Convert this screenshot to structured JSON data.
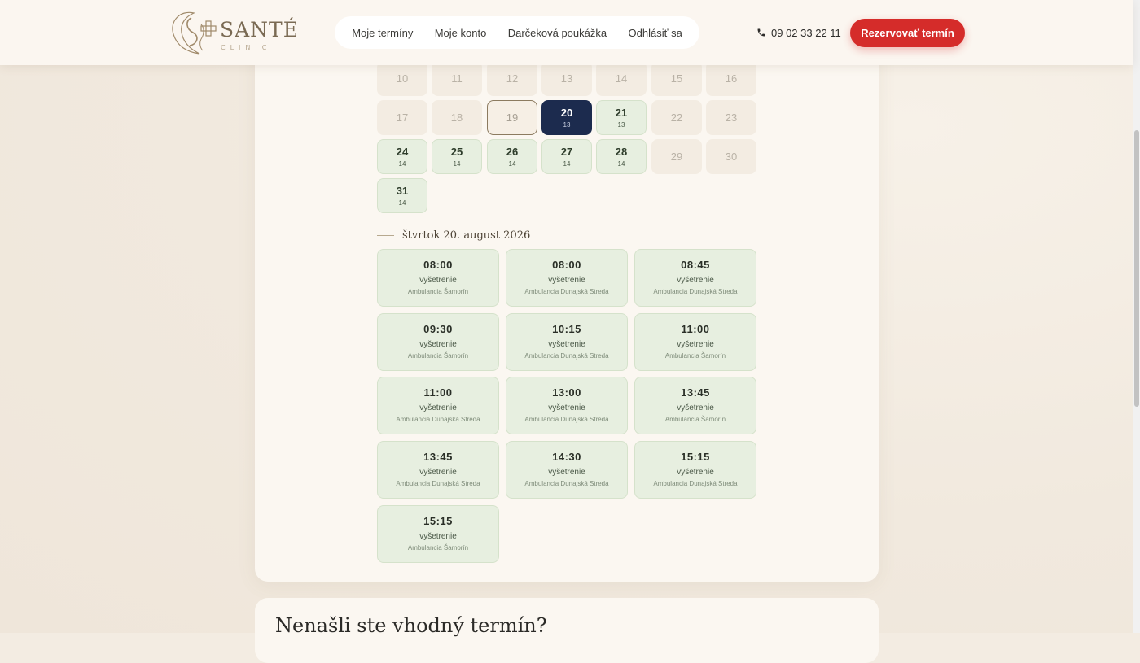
{
  "header": {
    "logo_text": "SANTÉ",
    "logo_sub": "CLINIC",
    "nav": [
      "Moje termíny",
      "Moje konto",
      "Darčeková poukážka",
      "Odhlásiť sa"
    ],
    "phone": "09 02 33 22 11",
    "cta": "Rezervovať termín"
  },
  "calendar": {
    "days": [
      {
        "n": "10",
        "c": "",
        "state": "disabled"
      },
      {
        "n": "11",
        "c": "",
        "state": "disabled"
      },
      {
        "n": "12",
        "c": "",
        "state": "disabled"
      },
      {
        "n": "13",
        "c": "",
        "state": "disabled"
      },
      {
        "n": "14",
        "c": "",
        "state": "disabled"
      },
      {
        "n": "15",
        "c": "",
        "state": "disabled"
      },
      {
        "n": "16",
        "c": "",
        "state": "disabled"
      },
      {
        "n": "17",
        "c": "",
        "state": "disabled"
      },
      {
        "n": "18",
        "c": "",
        "state": "disabled"
      },
      {
        "n": "19",
        "c": "",
        "state": "today"
      },
      {
        "n": "20",
        "c": "13",
        "state": "selected"
      },
      {
        "n": "21",
        "c": "13",
        "state": "avail"
      },
      {
        "n": "22",
        "c": "",
        "state": "disabled"
      },
      {
        "n": "23",
        "c": "",
        "state": "disabled"
      },
      {
        "n": "24",
        "c": "14",
        "state": "avail"
      },
      {
        "n": "25",
        "c": "14",
        "state": "avail"
      },
      {
        "n": "26",
        "c": "14",
        "state": "avail"
      },
      {
        "n": "27",
        "c": "14",
        "state": "avail"
      },
      {
        "n": "28",
        "c": "14",
        "state": "avail"
      },
      {
        "n": "29",
        "c": "",
        "state": "disabled"
      },
      {
        "n": "30",
        "c": "",
        "state": "disabled"
      },
      {
        "n": "31",
        "c": "14",
        "state": "avail"
      }
    ]
  },
  "selected_date": "štvrtok 20. august 2026",
  "slots": [
    {
      "time": "08:00",
      "service": "vyšetrenie",
      "location": "Ambulancia Šamorín"
    },
    {
      "time": "08:00",
      "service": "vyšetrenie",
      "location": "Ambulancia Dunajská Streda"
    },
    {
      "time": "08:45",
      "service": "vyšetrenie",
      "location": "Ambulancia Dunajská Streda"
    },
    {
      "time": "09:30",
      "service": "vyšetrenie",
      "location": "Ambulancia Šamorín"
    },
    {
      "time": "10:15",
      "service": "vyšetrenie",
      "location": "Ambulancia Dunajská Streda"
    },
    {
      "time": "11:00",
      "service": "vyšetrenie",
      "location": "Ambulancia Šamorín"
    },
    {
      "time": "11:00",
      "service": "vyšetrenie",
      "location": "Ambulancia Dunajská Streda"
    },
    {
      "time": "13:00",
      "service": "vyšetrenie",
      "location": "Ambulancia Dunajská Streda"
    },
    {
      "time": "13:45",
      "service": "vyšetrenie",
      "location": "Ambulancia Šamorín"
    },
    {
      "time": "13:45",
      "service": "vyšetrenie",
      "location": "Ambulancia Dunajská Streda"
    },
    {
      "time": "14:30",
      "service": "vyšetrenie",
      "location": "Ambulancia Dunajská Streda"
    },
    {
      "time": "15:15",
      "service": "vyšetrenie",
      "location": "Ambulancia Dunajská Streda"
    },
    {
      "time": "15:15",
      "service": "vyšetrenie",
      "location": "Ambulancia Šamorín"
    }
  ],
  "next_section_title": "Nenašli ste vhodný termín?",
  "colors": {
    "accent": "#d52c2a",
    "selected": "#1c2b4e",
    "available": "#e7efe0"
  }
}
